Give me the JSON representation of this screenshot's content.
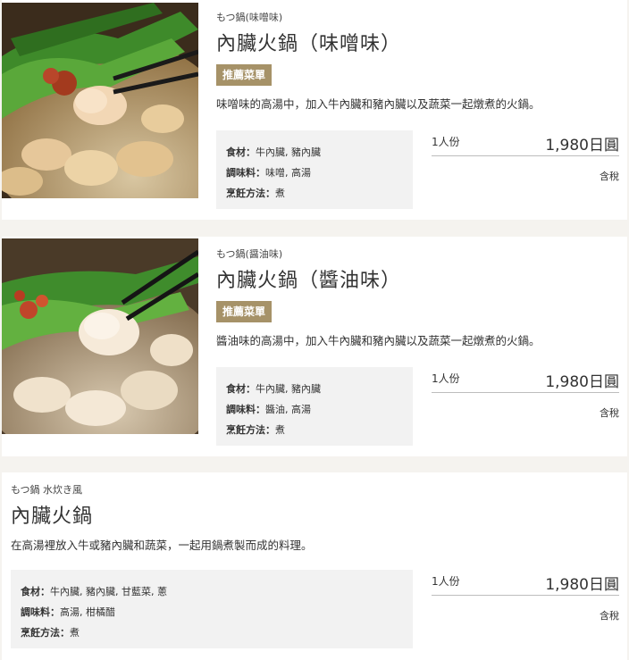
{
  "items": [
    {
      "subtitle": "もつ鍋(味噌味)",
      "title": "內臟火鍋（味噌味）",
      "badge": "推薦菜單",
      "description": "味噌味的高湯中，加入牛內臟和豬內臟以及蔬菜一起燉煮的火鍋。",
      "ingredients_label": "食材：",
      "ingredients": "牛內臟, 豬內臟",
      "seasoning_label": "調味料：",
      "seasoning": "味噌, 高湯",
      "method_label": "烹飪方法：",
      "method": "煮",
      "portion": "1人份",
      "price": "1,980日圓",
      "tax": "含稅"
    },
    {
      "subtitle": "もつ鍋(醤油味)",
      "title": "內臟火鍋（醬油味）",
      "badge": "推薦菜單",
      "description": "醬油味的高湯中，加入牛內臟和豬內臟以及蔬菜一起燉煮的火鍋。",
      "ingredients_label": "食材：",
      "ingredients": "牛內臟, 豬內臟",
      "seasoning_label": "調味料：",
      "seasoning": "醬油, 高湯",
      "method_label": "烹飪方法：",
      "method": "煮",
      "portion": "1人份",
      "price": "1,980日圓",
      "tax": "含稅"
    },
    {
      "subtitle": "もつ鍋 水炊き風",
      "title": "內臟火鍋",
      "description": "在高湯裡放入牛或豬內臟和蔬菜，一起用鍋煮製而成的料理。",
      "ingredients_label": "食材：",
      "ingredients": "牛內臟, 豬內臟, 甘藍菜, 蔥",
      "seasoning_label": "調味料：",
      "seasoning": "高湯, 柑橘醋",
      "method_label": "烹飪方法：",
      "method": "煮",
      "portion": "1人份",
      "price": "1,980日圓",
      "tax": "含稅"
    }
  ],
  "colors": {
    "badge": "#a69268",
    "page_background": "#f5f3ef",
    "info_box": "#f2f2f2"
  }
}
